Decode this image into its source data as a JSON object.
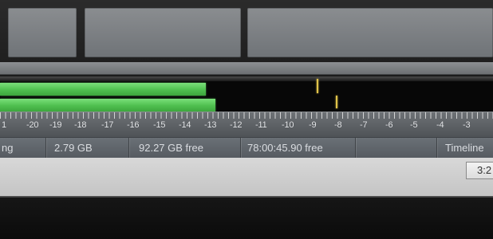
{
  "meters": {
    "channels": [
      {
        "name": "channel-1",
        "level_db": -13.4,
        "peak_db": -9.1
      },
      {
        "name": "channel-2",
        "level_db": -12.9,
        "peak_db": -8.1
      }
    ],
    "level_color": "#5ccb5c",
    "peak_color": "#e0c34a"
  },
  "scale": {
    "labels": [
      "1",
      "-20",
      "-19",
      "-18",
      "-17",
      "-16",
      "-15",
      "-14",
      "-13",
      "-12",
      "-11",
      "-10",
      "-9",
      "-8",
      "-7",
      "-6",
      "-5",
      "-4",
      "-3"
    ]
  },
  "status_bar": {
    "cells": [
      {
        "name": "status-cell-recording-format",
        "text": "ng"
      },
      {
        "name": "status-cell-disk-used",
        "text": "2.79 GB"
      },
      {
        "name": "status-cell-disk-free",
        "text": "92.27 GB free"
      },
      {
        "name": "status-cell-time-free",
        "text": "78:00:45.90 free"
      },
      {
        "name": "status-cell-empty",
        "text": ""
      },
      {
        "name": "status-cell-timeline",
        "text": "Timeline"
      }
    ]
  },
  "time_display": "3:2"
}
